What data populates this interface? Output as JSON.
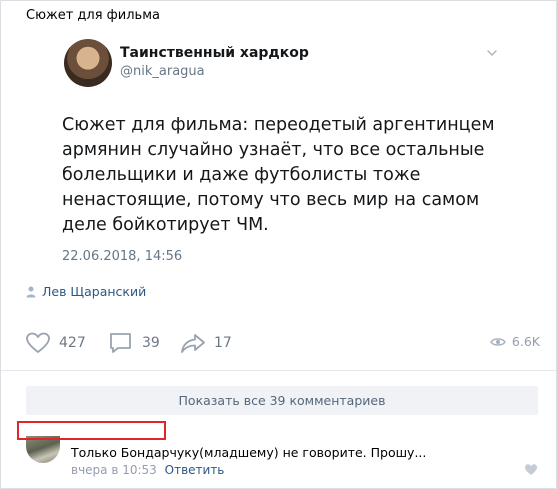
{
  "post": {
    "text": "Сюжет для фильма",
    "author_signature": "Лев Щаранский"
  },
  "tweet": {
    "author_name": "Таинственный хардкор",
    "author_handle": "@nik_aragua",
    "body": "Сюжет для фильма: переодетый аргентинцем армянин случайно узнаёт, что все остальные болельщики и даже футболисты тоже ненастоящие, потому что весь мир на самом деле бойкотирует ЧМ.",
    "date": "22.06.2018, 14:56"
  },
  "actions": {
    "likes": "427",
    "comments": "39",
    "shares": "17",
    "views": "6.6K"
  },
  "comments": {
    "show_all_label": "Показать все 39 комментариев",
    "items": [
      {
        "text": "Только Бондарчуку(младшему) не говорите. Прошу...",
        "time": "вчера в 10:53",
        "reply_label": "Ответить"
      }
    ]
  },
  "colors": {
    "link": "#2a5885",
    "muted": "#939cb0",
    "highlight": "#e0262b",
    "button_bg": "#f0f2f5"
  },
  "icons": [
    "chevron-down-icon",
    "user-icon",
    "heart-icon",
    "comment-icon",
    "share-icon",
    "eye-icon"
  ]
}
